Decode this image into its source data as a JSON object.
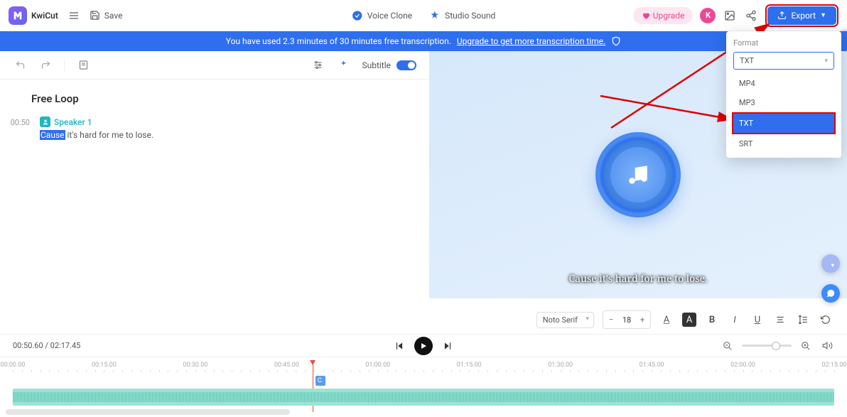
{
  "app": {
    "name": "KwiCut",
    "save": "Save"
  },
  "tools": {
    "voice_clone": "Voice Clone",
    "studio_sound": "Studio Sound"
  },
  "header": {
    "upgrade": "Upgrade",
    "avatar_letter": "K",
    "export": "Export"
  },
  "banner": {
    "text": "You have used 2.3 minutes of 30 minutes free transcription.",
    "link": "Upgrade to get more transcription time."
  },
  "left_toolbar": {
    "subtitle": "Subtitle"
  },
  "transcript": {
    "title": "Free Loop",
    "timestamp": "00:50",
    "speaker": "Speaker 1",
    "highlight": "Cause",
    "line_rest": " it's hard for me to lose."
  },
  "preview": {
    "caption": "Cause it's hard for me to lose."
  },
  "text_toolbar": {
    "font": "Noto Serif",
    "size": "18"
  },
  "playback": {
    "current": "00:50.60",
    "total": "02:17.45"
  },
  "timeline": {
    "labels": [
      "00:00.00",
      "00:15.00",
      "00:30.00",
      "00:45.00",
      "01:00.00",
      "01:15.00",
      "01:30.00",
      "01:45.00",
      "02:00.00",
      "02:15.00"
    ],
    "marker": "C.",
    "playhead_pct": 36.5
  },
  "format_panel": {
    "label": "Format",
    "value": "TXT",
    "options": [
      "MP4",
      "MP3",
      "TXT",
      "SRT"
    ],
    "selected": "TXT"
  }
}
